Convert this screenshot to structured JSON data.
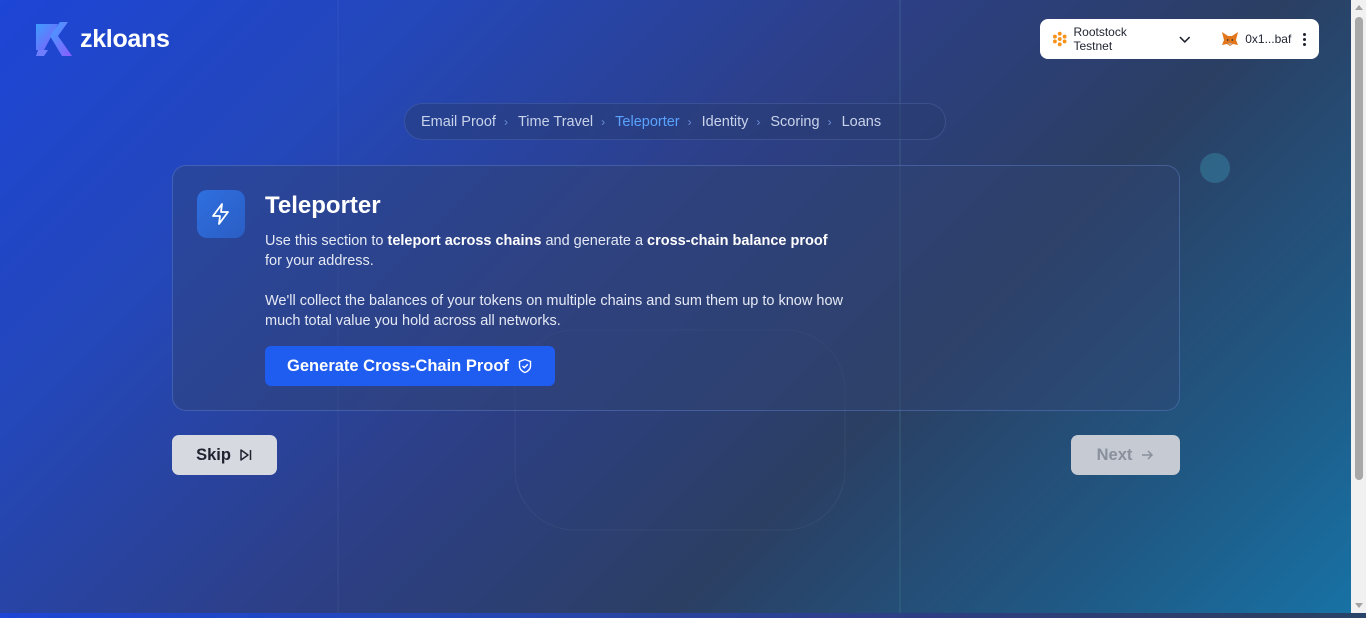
{
  "brand": {
    "name": "zkloans",
    "logo": "zk-logo-icon"
  },
  "wallet": {
    "network_label": "Rootstock Testnet",
    "network_icon": "rootstock-icon",
    "account_label": "0x1...baf",
    "account_icon": "metamask-fox-icon"
  },
  "breadcrumb": {
    "items": [
      {
        "label": "Email Proof",
        "active": false
      },
      {
        "label": "Time Travel",
        "active": false
      },
      {
        "label": "Teleporter",
        "active": true
      },
      {
        "label": "Identity",
        "active": false
      },
      {
        "label": "Scoring",
        "active": false
      },
      {
        "label": "Loans",
        "active": false
      }
    ]
  },
  "card": {
    "icon": "lightning-icon",
    "title": "Teleporter",
    "p1_a": "Use this section to ",
    "p1_b": "teleport across chains",
    "p1_c": " and generate a ",
    "p1_d": "cross-chain balance proof",
    "p1_e": " for your address.",
    "p2": "We'll collect the balances of your tokens on multiple chains and sum them up to know how much total value you hold across all networks.",
    "button_label": "Generate Cross-Chain Proof"
  },
  "nav": {
    "skip_label": "Skip",
    "next_label": "Next"
  },
  "colors": {
    "primary": "#1f5cf0",
    "active_crumb": "#5aa3ff"
  }
}
